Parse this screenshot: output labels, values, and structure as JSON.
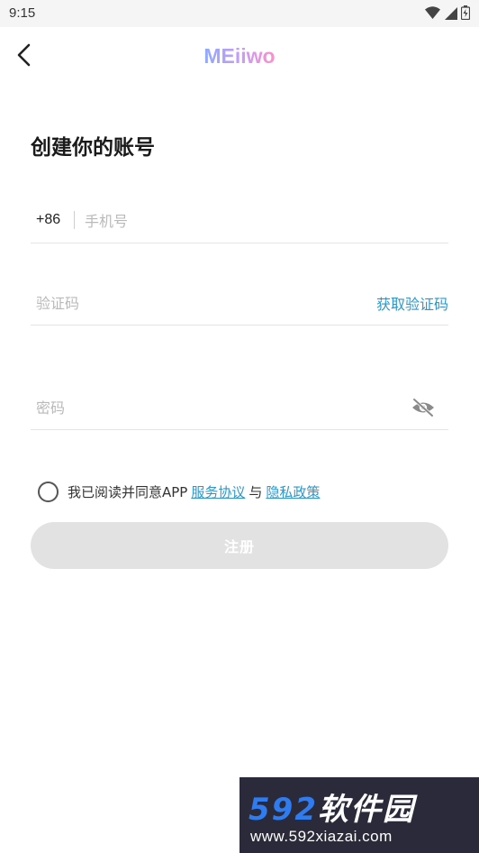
{
  "status_bar": {
    "time": "9:15"
  },
  "header": {
    "logo": "MEiiwo"
  },
  "title": "创建你的账号",
  "phone": {
    "prefix": "+86",
    "placeholder": "手机号"
  },
  "code": {
    "placeholder": "验证码",
    "get_code_label": "获取验证码"
  },
  "password": {
    "placeholder": "密码"
  },
  "agreement": {
    "text": "我已阅读并同意APP",
    "service_link": "服务协议",
    "and": "与",
    "privacy_link": "隐私政策"
  },
  "register_label": "注册",
  "watermark": {
    "numbers": "592",
    "brand": "软件园",
    "url": "www.592xiazai.com"
  },
  "colors": {
    "accent": "#2e97c9",
    "button_disabled": "#e2e2e2"
  }
}
